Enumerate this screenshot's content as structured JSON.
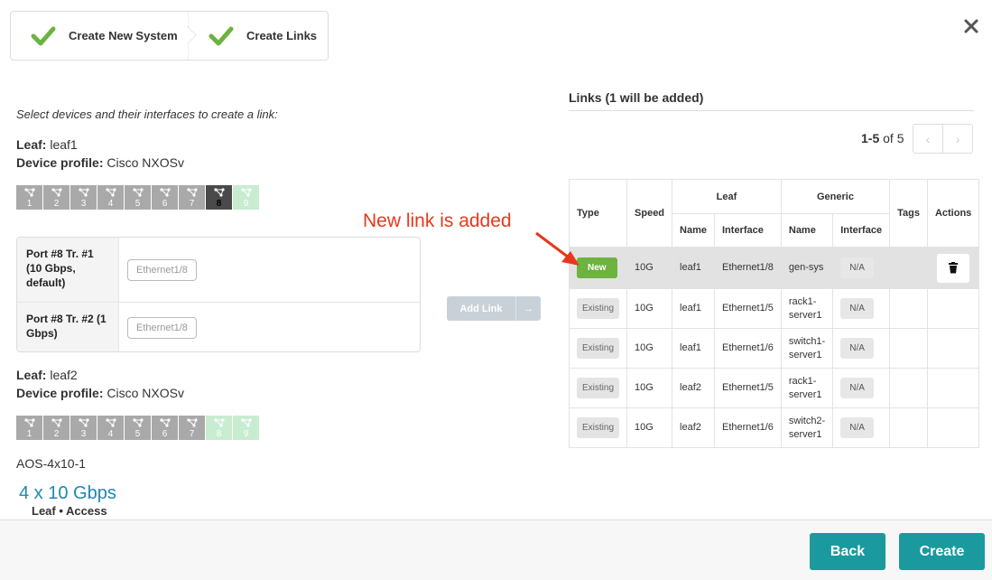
{
  "steps": [
    {
      "label": "Create New System"
    },
    {
      "label": "Create Links"
    }
  ],
  "instruction": "Select devices and their interfaces to create a link:",
  "leaf1": {
    "leaf_label": "Leaf:",
    "leaf_name": "leaf1",
    "profile_label": "Device profile:",
    "profile_name": "Cisco NXOSv",
    "ports": [
      "1",
      "2",
      "3",
      "4",
      "5",
      "6",
      "7",
      "8",
      "9"
    ]
  },
  "transformations": [
    {
      "label": "Port #8 Tr. #1 (10 Gbps, default)",
      "interface": "Ethernet1/8"
    },
    {
      "label": "Port #8 Tr. #2 (1 Gbps)",
      "interface": "Ethernet1/8"
    }
  ],
  "add_link": {
    "label": "Add Link",
    "arrow": "→"
  },
  "leaf2": {
    "leaf_label": "Leaf:",
    "leaf_name": "leaf2",
    "profile_label": "Device profile:",
    "profile_name": "Cisco NXOSv",
    "ports": [
      "1",
      "2",
      "3",
      "4",
      "5",
      "6",
      "7",
      "8",
      "9"
    ]
  },
  "logical_device": {
    "name": "AOS-4x10-1",
    "speed": "4 x 10 Gbps",
    "roles": "Leaf • Access"
  },
  "links": {
    "title": "Links (1 will be added)",
    "pager_range": "1-5",
    "pager_of": "of 5",
    "headers": {
      "type": "Type",
      "speed": "Speed",
      "leaf": "Leaf",
      "generic": "Generic",
      "tags": "Tags",
      "actions": "Actions",
      "name": "Name",
      "interface": "Interface"
    },
    "rows": [
      {
        "type": "New",
        "speed": "10G",
        "leaf_name": "leaf1",
        "leaf_if": "Ethernet1/8",
        "gen_name": "gen-sys",
        "gen_if": "N/A"
      },
      {
        "type": "Existing",
        "speed": "10G",
        "leaf_name": "leaf1",
        "leaf_if": "Ethernet1/5",
        "gen_name": "rack1-server1",
        "gen_if": "N/A"
      },
      {
        "type": "Existing",
        "speed": "10G",
        "leaf_name": "leaf1",
        "leaf_if": "Ethernet1/6",
        "gen_name": "switch1-server1",
        "gen_if": "N/A"
      },
      {
        "type": "Existing",
        "speed": "10G",
        "leaf_name": "leaf2",
        "leaf_if": "Ethernet1/5",
        "gen_name": "rack1-server1",
        "gen_if": "N/A"
      },
      {
        "type": "Existing",
        "speed": "10G",
        "leaf_name": "leaf2",
        "leaf_if": "Ethernet1/6",
        "gen_name": "switch2-server1",
        "gen_if": "N/A"
      }
    ]
  },
  "annotation": "New link is added",
  "footer": {
    "back": "Back",
    "create": "Create"
  },
  "colors": {
    "accent": "#1a9a9e",
    "new_badge": "#6cb33f",
    "annotation": "#e8381b",
    "check": "#6cb33f"
  }
}
